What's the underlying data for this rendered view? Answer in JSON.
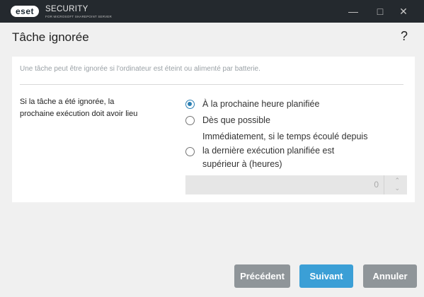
{
  "titlebar": {
    "logo_text": "eset",
    "brand": "SECURITY",
    "brand_sub": "FOR MICROSOFT SHAREPOINT SERVER",
    "minimize_icon": "minimize-icon",
    "maximize_icon": "maximize-icon",
    "close_icon": "close-icon"
  },
  "page": {
    "title": "Tâche ignorée",
    "help": "?"
  },
  "panel": {
    "description": "Une tâche peut être ignorée si l'ordinateur est éteint ou alimenté par batterie.",
    "setting_label": "Si la tâche a été ignorée, la prochaine exécution doit avoir lieu",
    "options": [
      {
        "label": "À la prochaine heure planifiée",
        "checked": true
      },
      {
        "label": "Dès que possible",
        "checked": false
      },
      {
        "label_lines": [
          "Immédiatement, si le temps écoulé depuis",
          "la dernière exécution planifiée est",
          "supérieur à (heures)"
        ],
        "checked": false
      }
    ],
    "hours_value": "0"
  },
  "buttons": {
    "previous": "Précédent",
    "next": "Suivant",
    "cancel": "Annuler"
  },
  "colors": {
    "accent": "#3b9fd6",
    "titlebar": "#24292e",
    "button_grey": "#8f9599"
  }
}
